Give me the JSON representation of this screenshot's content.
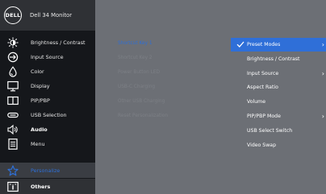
{
  "header": {
    "logo": "DELL",
    "title": "Dell 34 Monitor"
  },
  "menu": [
    {
      "label": "Brightness / Contrast",
      "icon": "brightness-icon"
    },
    {
      "label": "Input Source",
      "icon": "input-source-icon"
    },
    {
      "label": "Color",
      "icon": "color-icon"
    },
    {
      "label": "Display",
      "icon": "display-icon"
    },
    {
      "label": "PIP/PBP",
      "icon": "pip-pbp-icon"
    },
    {
      "label": "USB Selection",
      "icon": "usb-icon"
    },
    {
      "label": "Audio",
      "icon": "audio-icon"
    },
    {
      "label": "Menu",
      "icon": "menu-icon"
    },
    {
      "label": "Personalize",
      "icon": "star-icon"
    },
    {
      "label": "Others",
      "icon": "others-icon"
    }
  ],
  "middle": [
    "Shortcut Key 1",
    "Shortcut Key 2",
    "Power Button LED",
    "USB-C Charging",
    "Other USB Charging",
    "Reset Personalization"
  ],
  "options": [
    "Preset Modes",
    "Brightness / Contrast",
    "Input Source",
    "Aspect Ratio",
    "Volume",
    "PIP/PBP Mode",
    "USB Select Switch",
    "Video Swap"
  ],
  "colors": {
    "accent": "#2f6fd8",
    "panel": "#6c6f75",
    "sidebar": "#15171b"
  }
}
